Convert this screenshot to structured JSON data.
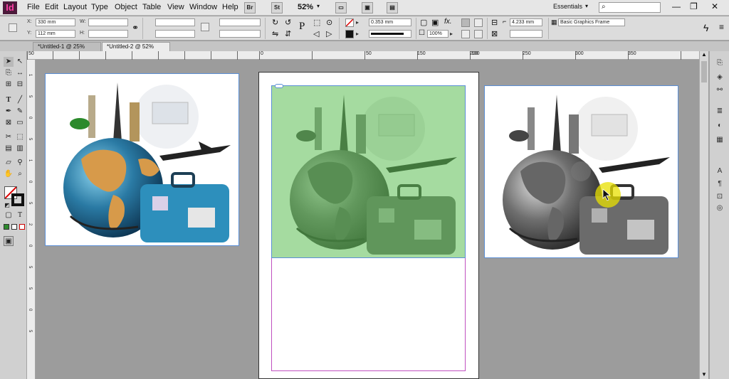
{
  "app": {
    "logo": "Id"
  },
  "menu": [
    "File",
    "Edit",
    "Layout",
    "Type",
    "Object",
    "Table",
    "View",
    "Window",
    "Help"
  ],
  "menu_tools": {
    "br": "Br",
    "st": "St",
    "zoom": "52%"
  },
  "workspace": {
    "name": "Essentials"
  },
  "search": {
    "icon": "search-icon",
    "value": ""
  },
  "control": {
    "x_label": "X:",
    "x": "330 mm",
    "y_label": "Y:",
    "y": "112 mm",
    "w_label": "W:",
    "w": "",
    "h_label": "H:",
    "h": "",
    "stroke_weight": "0.353 mm",
    "opacity": "100%",
    "fitting": "4.233 mm",
    "object_style": "Basic Graphics Frame"
  },
  "tabs": [
    {
      "label": "*Untitled-1 @ 25%",
      "active": false
    },
    {
      "label": "*Untitled-2 @ 52%",
      "active": true
    }
  ],
  "ruler": {
    "ticks": [
      "50",
      "0",
      "50",
      "100",
      "150",
      "200",
      "250",
      "300",
      "350"
    ]
  },
  "vruler": {
    "ticks": [
      "1",
      "5",
      "0",
      "5",
      "1",
      "0",
      "5",
      "2",
      "0",
      "5",
      "5",
      "0",
      "5"
    ]
  },
  "colors": {
    "accent": "#5b8fd6",
    "selection": "#8acb82",
    "cursor": "#e8e000"
  }
}
